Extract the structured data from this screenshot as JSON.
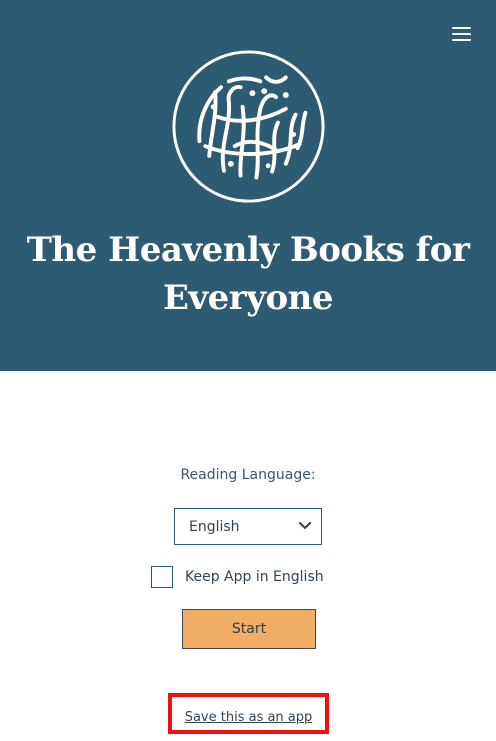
{
  "header": {
    "background": "#2e5b74",
    "logo_icon": "calligraphy-seal-logo",
    "menu_icon": "hamburger-menu-icon",
    "title_line1": "The Heavenly Books for",
    "title_line2": "Everyone"
  },
  "form": {
    "language_label": "Reading Language:",
    "language_selected": "English",
    "keep_english_label": "Keep App in English",
    "keep_english_checked": false,
    "start_label": "Start",
    "start_color": "#f0ad66"
  },
  "footer": {
    "save_app_label": "Save this as an app",
    "highlight_color": "#ee1111"
  }
}
